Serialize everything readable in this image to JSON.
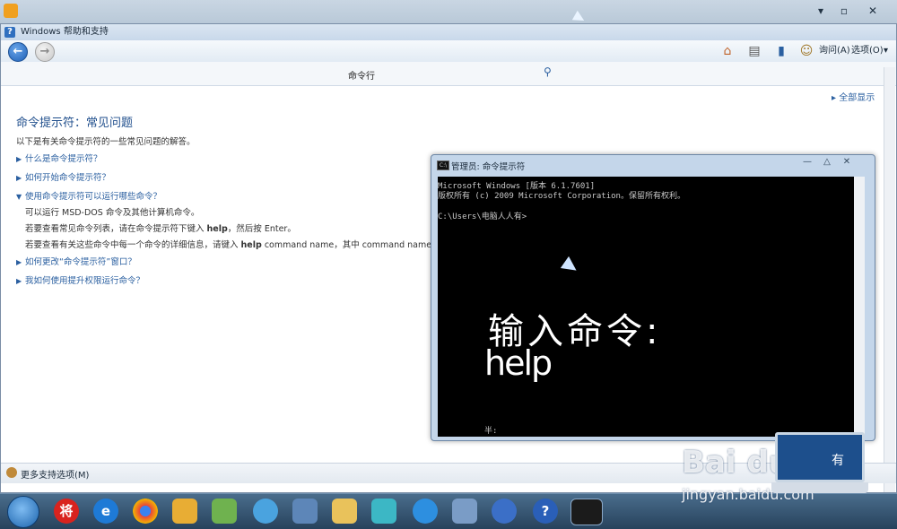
{
  "window": {
    "title": "Windows 帮助和支持"
  },
  "toolbar": {
    "ask_label": "询问(A)",
    "options_label": "选项(O)"
  },
  "search": {
    "value": "命令行"
  },
  "content": {
    "show_all": "全部显示",
    "title": "命令提示符：常见问题",
    "intro": "以下是有关命令提示符的一些常见问题的解答。",
    "faq": [
      {
        "label": "什么是命令提示符？",
        "expanded": false
      },
      {
        "label": "如何开始命令提示符？",
        "expanded": false
      },
      {
        "label": "使用命令提示符可以运行哪些命令？",
        "expanded": true
      },
      {
        "label": "如何更改“命令提示符”窗口？",
        "expanded": false
      },
      {
        "label": "我如何使用提升权限运行命令？",
        "expanded": false
      }
    ],
    "answer": {
      "line1": "可以运行 MSD-DOS 命令及其他计算机命令。",
      "line2_pre": "若要查看常见命令列表，请在命令提示符下键入 ",
      "line2_cmd": "help",
      "line2_post": "，然后按 Enter。",
      "line3_pre": "若要查看有关这些命令中每一个命令的详细信息，请键入 ",
      "line3_cmd": "help",
      "line3_post": " command name，其中 command name 是您要了解"
    }
  },
  "status": {
    "more_support": "更多支持选项(M)"
  },
  "cmd": {
    "title": "管理员: 命令提示符",
    "line1": "Microsoft Windows [版本 6.1.7601]",
    "line2": "版权所有 (c) 2009 Microsoft Corporation。保留所有权利。",
    "prompt": "C:\\Users\\电脑人人有>",
    "overlay_title": "输入命令:",
    "overlay_cmd": "help",
    "ime": "半:"
  },
  "taskbar": {
    "app1_label": "将",
    "app2_label": "e"
  },
  "watermark": {
    "brand": "Bai du 经验",
    "url": "jingyan.baidu.com",
    "laptop_text": "有"
  },
  "colors": {
    "accent": "#2a5fa0",
    "title_blue": "#1f4e8c",
    "console_bg": "#000000"
  }
}
